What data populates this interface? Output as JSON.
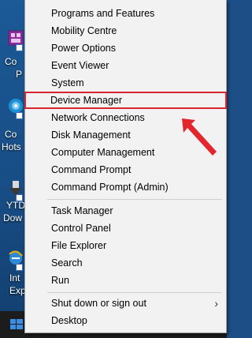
{
  "menu": {
    "items": [
      {
        "label": "Programs and Features"
      },
      {
        "label": "Mobility Centre"
      },
      {
        "label": "Power Options"
      },
      {
        "label": "Event Viewer"
      },
      {
        "label": "System"
      },
      {
        "label": "Device Manager"
      },
      {
        "label": "Network Connections"
      },
      {
        "label": "Disk Management"
      },
      {
        "label": "Computer Management"
      },
      {
        "label": "Command Prompt"
      },
      {
        "label": "Command Prompt (Admin)"
      },
      {
        "label": "Task Manager"
      },
      {
        "label": "Control Panel"
      },
      {
        "label": "File Explorer"
      },
      {
        "label": "Search"
      },
      {
        "label": "Run"
      },
      {
        "label": "Shut down or sign out"
      },
      {
        "label": "Desktop"
      }
    ],
    "highlighted_item": "Device Manager",
    "submenu_chevron": "chevron-right-icon"
  },
  "desktop_icons": [
    {
      "label_line1": "Co",
      "label_line2": "P",
      "icon": "control-panel-icon"
    },
    {
      "label_line1": "Co",
      "label_line2": "Hots",
      "icon": "hotspot-icon"
    },
    {
      "label_line1": "YTD",
      "label_line2": "Dow",
      "icon": "ytd-downloader-icon"
    },
    {
      "label_line1": "Int",
      "label_line2": "Exp",
      "icon": "internet-explorer-icon"
    }
  ],
  "colors": {
    "menu_background": "#f2f2f2",
    "highlight_border": "#d9252f",
    "pointer_arrow": "#e3262e",
    "taskbar": "#1c1c1c",
    "start_logo": "#3a8ee6"
  }
}
